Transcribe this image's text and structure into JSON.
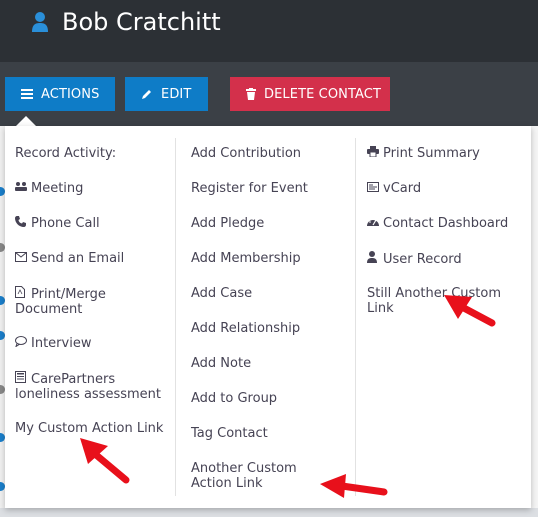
{
  "header": {
    "contact_name": "Bob Cratchitt"
  },
  "toolbar": {
    "actions_label": "ACTIONS",
    "edit_label": "EDIT",
    "delete_label": "DELETE CONTACT"
  },
  "menu": {
    "col1": {
      "heading": "Record Activity:",
      "items": [
        {
          "label": "Meeting",
          "icon": "group-icon"
        },
        {
          "label": "Phone Call",
          "icon": "phone-icon"
        },
        {
          "label": "Send an Email",
          "icon": "envelope-icon"
        },
        {
          "label": "Print/Merge Document",
          "icon": "pdf-file-icon"
        },
        {
          "label": "Interview",
          "icon": "speech-bubble-icon"
        },
        {
          "label": "CarePartners loneliness assessment",
          "icon": "form-icon"
        },
        {
          "label": "My Custom Action Link",
          "icon": ""
        }
      ]
    },
    "col2": {
      "items": [
        {
          "label": "Add Contribution"
        },
        {
          "label": "Register for Event"
        },
        {
          "label": "Add Pledge"
        },
        {
          "label": "Add Membership"
        },
        {
          "label": "Add Case"
        },
        {
          "label": "Add Relationship"
        },
        {
          "label": "Add Note"
        },
        {
          "label": "Add to Group"
        },
        {
          "label": "Tag Contact"
        },
        {
          "label": "Another Custom Action Link"
        }
      ]
    },
    "col3": {
      "items": [
        {
          "label": "Print Summary",
          "icon": "print-icon"
        },
        {
          "label": "vCard",
          "icon": "vcard-icon"
        },
        {
          "label": "Contact Dashboard",
          "icon": "dashboard-icon"
        },
        {
          "label": "User Record",
          "icon": "user-icon"
        },
        {
          "label": "Still Another Custom Link",
          "icon": ""
        }
      ]
    }
  },
  "colors": {
    "header_bg": "#2c3035",
    "toolbar_bg": "#3b4046",
    "primary": "#0e7cc7",
    "danger": "#d3304b",
    "annotation_arrow": "#e8101b"
  }
}
